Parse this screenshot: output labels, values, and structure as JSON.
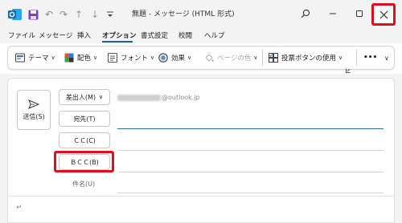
{
  "window": {
    "title": "無題 - メッセージ (HTML 形式)"
  },
  "menu": {
    "items": [
      "ファイル",
      "メッセージ",
      "挿入",
      "オプション",
      "書式設定",
      "校閲",
      "ヘルプ"
    ],
    "active": "オプション"
  },
  "ribbon": {
    "theme": "テーマ",
    "color": "配色",
    "font": "フォント",
    "effects": "効果",
    "page_color": "ページの色",
    "voting": "投票ボタンの使用",
    "more": "•••"
  },
  "compose": {
    "send_label": "送信(S)",
    "from_button": "差出人(M)",
    "from_value_suffix": "@outlook.jp",
    "to_button": "宛先(T)",
    "cc_button": "ＣＣ(C)",
    "bcc_button": "ＢＣＣ(B)",
    "subject_label": "件名(U)",
    "paragraph_mark": "↵"
  },
  "colors": {
    "highlight": "#e10c1c",
    "accent": "#1a5fb4",
    "outlook_blue": "#0f6cbd"
  }
}
